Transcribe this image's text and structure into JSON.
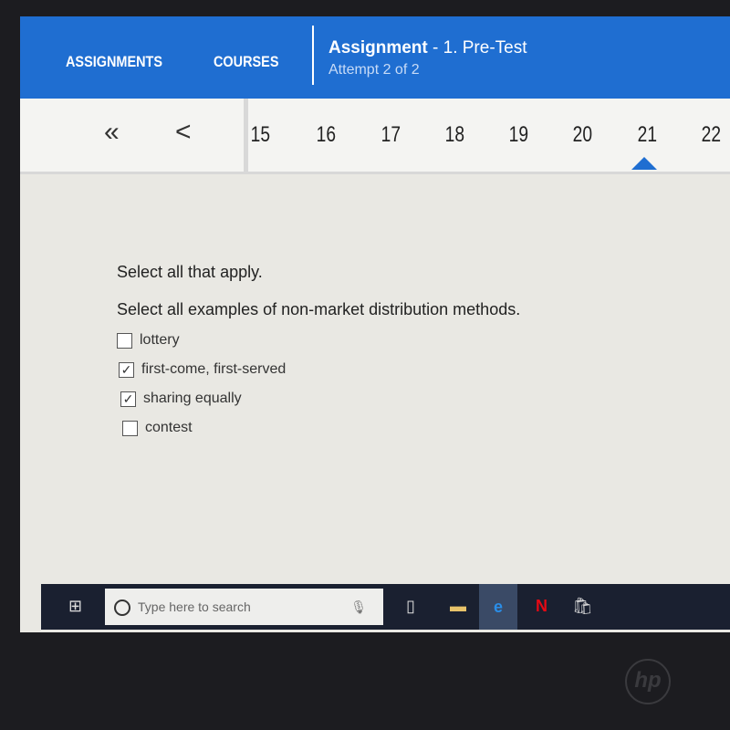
{
  "header": {
    "nav": [
      "ASSIGNMENTS",
      "COURSES"
    ],
    "title": "Assignment",
    "subtitle": "- 1. Pre-Test",
    "attempt": "Attempt 2 of 2",
    "color": "#1f6ed1"
  },
  "pager": {
    "first": "«",
    "prev": "<",
    "pages": [
      "15",
      "16",
      "17",
      "18",
      "19",
      "20",
      "21",
      "22"
    ],
    "current": "21"
  },
  "question": {
    "instruction": "Select all that apply.",
    "prompt": "Select all examples of non-market distribution methods.",
    "options": [
      {
        "label": "lottery",
        "checked": false
      },
      {
        "label": "first-come, first-served",
        "checked": true
      },
      {
        "label": "sharing equally",
        "checked": true
      },
      {
        "label": "contest",
        "checked": false
      }
    ]
  },
  "taskbar": {
    "search_placeholder": "Type here to search",
    "icons": [
      "windows-icon",
      "microphone-icon",
      "task-view-icon",
      "file-explorer-icon",
      "edge-icon",
      "netflix-icon",
      "store-icon"
    ]
  },
  "bezel": {
    "logo": "hp"
  }
}
